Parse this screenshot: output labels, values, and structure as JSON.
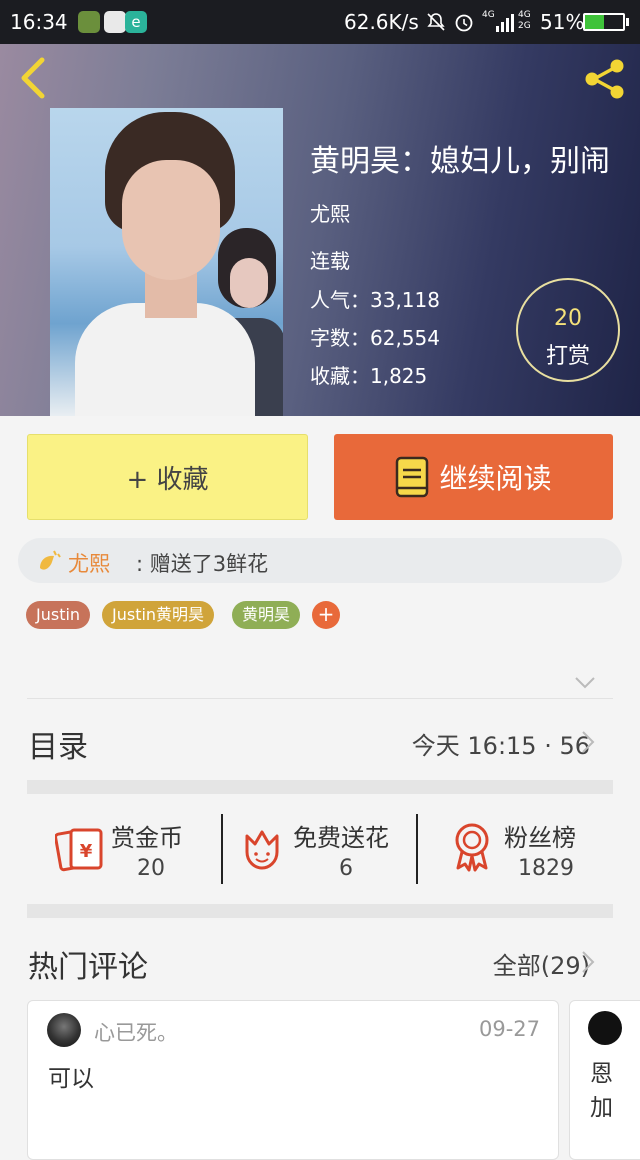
{
  "status_bar": {
    "time": "16:34",
    "net_speed": "62.6K/s",
    "battery": "51%",
    "signal_1": "4G",
    "signal_2": "4G",
    "signal_3": "2G"
  },
  "book": {
    "title": "黄明昊：媳妇儿，别闹",
    "author": "尤熙",
    "status": "连载",
    "stats": [
      {
        "label": "人气",
        "value": "33,118"
      },
      {
        "label": "字数",
        "value": "62,554"
      },
      {
        "label": "收藏",
        "value": "1,825"
      }
    ],
    "tip_count": "20",
    "tip_label": "打赏"
  },
  "actions": {
    "favorite": "+ 收藏",
    "continue_reading": "继续阅读"
  },
  "gift_notice": {
    "sender": "尤熙",
    "text": ": 赠送了3鲜花"
  },
  "tags": [
    {
      "label": "Justin",
      "color": "#c7735a"
    },
    {
      "label": "Justin黄明昊",
      "color": "#d0a43a"
    },
    {
      "label": "黄明昊",
      "color": "#8fae56"
    }
  ],
  "tag_add": "+",
  "toc": {
    "title": "目录",
    "latest": "今天 16:15 · 56"
  },
  "support": [
    {
      "label": "赏金币",
      "value": "20",
      "icon": "red-envelope-yen-icon"
    },
    {
      "label": "免费送花",
      "value": "6",
      "icon": "flower-icon"
    },
    {
      "label": "粉丝榜",
      "value": "1829",
      "icon": "ribbon-medal-icon"
    }
  ],
  "comments": {
    "title": "热门评论",
    "all_label": "全部(29)",
    "items": [
      {
        "user": "心已死。",
        "date": "09-27",
        "text": "可以"
      },
      {
        "user": "",
        "date": "",
        "text": "恩\n加"
      }
    ]
  },
  "colors": {
    "accent_orange": "#e8693a",
    "favorite_yellow": "#faf285",
    "icon_red": "#d9452c",
    "share_yellow": "#f2d534"
  }
}
